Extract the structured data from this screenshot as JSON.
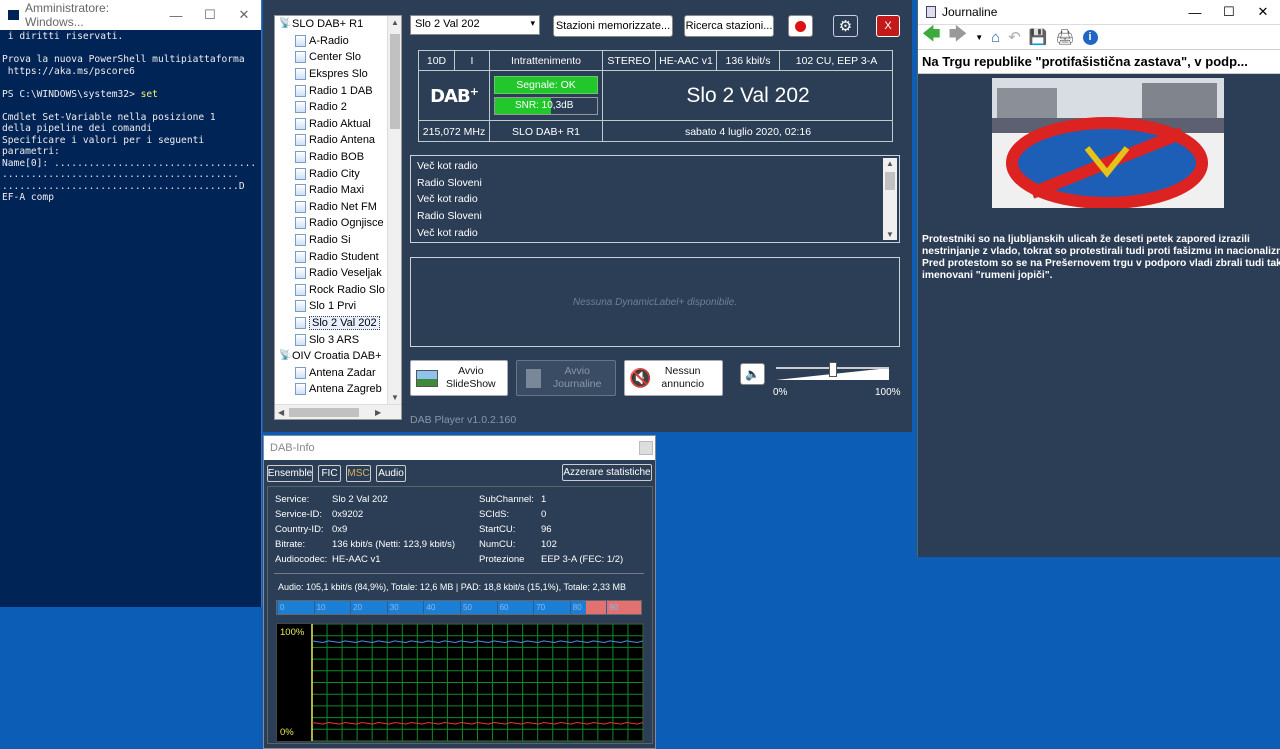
{
  "powershell": {
    "title": "Amministratore: Windows...",
    "lines": [
      " i diritti riservati.",
      "",
      "Prova la nuova PowerShell multipiattaforma",
      " https://aka.ms/pscore6",
      "",
      "PS C:\\WINDOWS\\system32> ",
      "",
      "Cmdlet Set-Variable nella posizione 1",
      "della pipeline dei comandi",
      "Specificare i valori per i seguenti",
      "parametri:",
      "Name[0]: ...................................",
      ".........................................",
      ".........................................D",
      "EF-A comp"
    ],
    "command": "set"
  },
  "dab": {
    "tree": [
      {
        "label": "SLO DAB+ R1",
        "type": "parent"
      },
      {
        "label": "A-Radio",
        "type": "child"
      },
      {
        "label": "Center Slo",
        "type": "child"
      },
      {
        "label": "Ekspres Slo",
        "type": "child"
      },
      {
        "label": "Radio 1 DAB",
        "type": "child"
      },
      {
        "label": "Radio 2",
        "type": "child"
      },
      {
        "label": "Radio Aktual",
        "type": "child"
      },
      {
        "label": "Radio Antena",
        "type": "child"
      },
      {
        "label": "Radio BOB",
        "type": "child"
      },
      {
        "label": "Radio City",
        "type": "child"
      },
      {
        "label": "Radio Maxi",
        "type": "child"
      },
      {
        "label": "Radio Net FM",
        "type": "child"
      },
      {
        "label": "Radio Ognjisce",
        "type": "child"
      },
      {
        "label": "Radio Si",
        "type": "child"
      },
      {
        "label": "Radio Student",
        "type": "child"
      },
      {
        "label": "Radio Veseljak",
        "type": "child"
      },
      {
        "label": "Rock Radio Slo",
        "type": "child"
      },
      {
        "label": "Slo 1 Prvi",
        "type": "child"
      },
      {
        "label": "Slo 2 Val 202",
        "type": "child",
        "selected": true
      },
      {
        "label": "Slo 3 ARS",
        "type": "child"
      },
      {
        "label": "OIV Croatia DAB+",
        "type": "parent"
      },
      {
        "label": "Antena Zadar",
        "type": "child"
      },
      {
        "label": "Antena Zagreb",
        "type": "child"
      }
    ],
    "station_select": "Slo 2 Val 202",
    "stations_btn": "Stazioni memorizzate...",
    "search_btn": "Ricerca stazioni...",
    "close_btn": "X",
    "info": {
      "channel": "10D",
      "pty_code": "I",
      "genre": "Intrattenimento",
      "mode": "STEREO",
      "codec": "HE-AAC v1",
      "bitrate": "136 kbit/s",
      "cu": "102 CU, EEP 3-A",
      "signal": "Segnale: OK",
      "snr": "SNR: 10,3dB",
      "snr_level": 0.55,
      "station_name": "Slo 2 Val 202",
      "frequency": "215,072 MHz",
      "ensemble": "SLO DAB+ R1",
      "datetime": "sabato 4 luglio 2020, 02:16"
    },
    "radiotext": [
      "Več kot radio",
      "Radio Sloveni",
      "Več kot radio",
      "Radio Sloveni",
      "Več kot radio"
    ],
    "dl_plus": "Nessuna DynamicLabel+ disponibile.",
    "btn_slideshow": "Avvio\nSlideShow",
    "btn_journaline": "Avvio\nJournaline",
    "btn_announce": "Nessun\nannuncio",
    "volume_min": "0%",
    "volume_max": "100%",
    "volume_level": 0.5,
    "version": "DAB Player v1.0.2.160"
  },
  "journaline": {
    "title": "Journaline",
    "headline": "Na Trgu republike \"protifašistična zastava\", v podp...",
    "body": "Protestniki so na ljubljanskih ulicah že deseti petek zapored izrazili\nnestrinjanje z vlado, tokrat so protestirali tudi proti fašizmu in nacionalizmu.\nPred protestom so se na Prešernovem trgu v podporo vladi zbrali tudi tako\nimenovani \"rumeni jopiči\"."
  },
  "dabinfo": {
    "title": "DAB-Info",
    "tabs": [
      "Ensemble",
      "FIC",
      "MSC",
      "Audio"
    ],
    "reset_btn": "Azzerare statistiche",
    "left": [
      [
        "Service:",
        "Slo 2 Val 202"
      ],
      [
        "Service-ID:",
        "0x9202"
      ],
      [
        "Country-ID:",
        "0x9"
      ],
      [
        "Bitrate:",
        "136 kbit/s (Netti: 123,9 kbit/s)"
      ],
      [
        "Audiocodec:",
        "HE-AAC v1"
      ]
    ],
    "right": [
      [
        "SubChannel:",
        "1"
      ],
      [
        "SCIdS:",
        "0"
      ],
      [
        "StartCU:",
        "96"
      ],
      [
        "NumCU:",
        "102"
      ],
      [
        "Protezione",
        "EEP 3-A (FEC: 1/2)"
      ]
    ],
    "audio_stats": "Audio: 105,1 kbit/s (84,9%), Totale: 12,6 MB | PAD: 18,8 kbit/s (15,1%), Totale: 2,33 MB",
    "scale": [
      "0",
      "10",
      "20",
      "30",
      "40",
      "50",
      "60",
      "70",
      "80",
      "90"
    ],
    "scale_fill": 0.849,
    "graph_top": "100%",
    "graph_bottom": "0%"
  }
}
